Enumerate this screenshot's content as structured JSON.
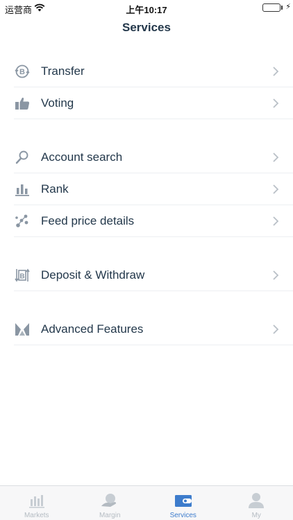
{
  "status_bar": {
    "carrier": "运营商",
    "time": "上午10:17",
    "battery_level": 1.0
  },
  "header": {
    "title": "Services"
  },
  "menu": {
    "groups": [
      {
        "items": [
          {
            "label": "Transfer",
            "icon": "bitshares-coin-icon"
          },
          {
            "label": "Voting",
            "icon": "thumbs-up-icon"
          }
        ]
      },
      {
        "items": [
          {
            "label": "Account search",
            "icon": "search-icon"
          },
          {
            "label": "Rank",
            "icon": "bar-chart-icon"
          },
          {
            "label": "Feed price details",
            "icon": "scatter-nodes-icon"
          }
        ]
      },
      {
        "items": [
          {
            "label": "Deposit & Withdraw",
            "icon": "deposit-withdraw-icon"
          }
        ]
      },
      {
        "items": [
          {
            "label": "Advanced Features",
            "icon": "advanced-features-icon"
          }
        ]
      }
    ]
  },
  "tab_bar": {
    "active": "Services",
    "tabs": [
      {
        "label": "Markets",
        "icon": "markets-icon"
      },
      {
        "label": "Margin",
        "icon": "margin-icon"
      },
      {
        "label": "Services",
        "icon": "services-wallet-icon"
      },
      {
        "label": "My",
        "icon": "profile-icon"
      }
    ]
  },
  "colors": {
    "text": "#23384b",
    "icon": "#8a96a3",
    "divider": "#eceff2",
    "tab_active": "#3d7ccc",
    "tab_inactive": "#b5bcc3",
    "battery": "#4cd964"
  }
}
